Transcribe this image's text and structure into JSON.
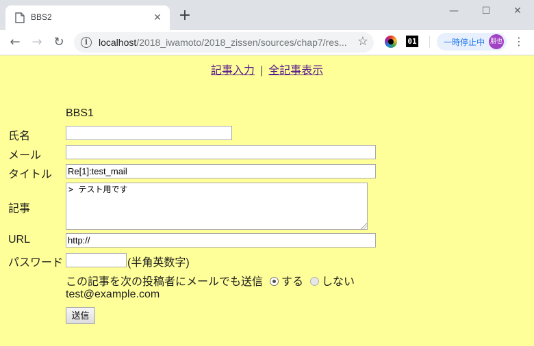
{
  "browser": {
    "tab_title": "BBS2",
    "tab_close": "✕",
    "new_tab": "+",
    "window_controls": {
      "minimize": "—",
      "maximize": "☐",
      "close": "✕"
    },
    "url_host": "localhost",
    "url_path": "/2018_iwamoto/2018_zissen/sources/chap7/res...",
    "extension_badge": "01",
    "paused_label": "一時停止中",
    "avatar_text": "朋也"
  },
  "page": {
    "nav": {
      "post_link": "記事入力",
      "separator": "|",
      "all_link": "全記事表示"
    },
    "bbs_title": "BBS1",
    "form": {
      "name_label": "氏名",
      "name_value": "",
      "mail_label": "メール",
      "mail_value": "",
      "title_label": "タイトル",
      "title_value": "Re[1]:test_mail",
      "body_label": "記事",
      "body_value": "> テスト用です",
      "url_label": "URL",
      "url_value": "http://",
      "password_label": "パスワード",
      "password_value": "",
      "password_note": "(半角英数字)",
      "mail_question": "この記事を次の投稿者にメールでも送信",
      "radio_yes": "する",
      "radio_no": "しない",
      "radio_selected": "する",
      "recipient_email": "test@example.com",
      "submit_label": "送信"
    }
  }
}
